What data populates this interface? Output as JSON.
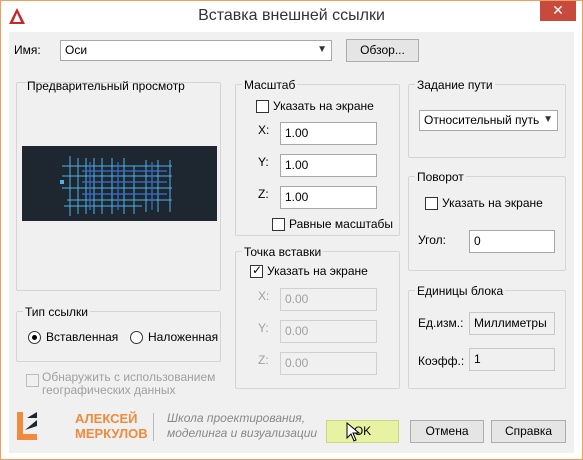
{
  "window": {
    "title": "Вставка внешней ссылки",
    "close_label": "✕"
  },
  "name_row": {
    "label": "Имя:",
    "value": "Оси",
    "browse_label": "Обзор..."
  },
  "preview": {
    "title": "Предварительный просмотр"
  },
  "scale": {
    "title": "Масштаб",
    "specify_on_screen": "Указать на экране",
    "x_label": "X:",
    "x_value": "1.00",
    "y_label": "Y:",
    "y_value": "1.00",
    "z_label": "Z:",
    "z_value": "1.00",
    "uniform_label": "Равные масштабы"
  },
  "path": {
    "title": "Задание пути",
    "value": "Относительный путь"
  },
  "rotation": {
    "title": "Поворот",
    "specify_on_screen": "Указать на экране",
    "angle_label": "Угол:",
    "angle_value": "0"
  },
  "insertion": {
    "title": "Точка вставки",
    "specify_on_screen": "Указать на экране",
    "x_label": "X:",
    "x_value": "0.00",
    "y_label": "Y:",
    "y_value": "0.00",
    "z_label": "Z:",
    "z_value": "0.00"
  },
  "reference_type": {
    "title": "Тип ссылки",
    "attached": "Вставленная",
    "overlay": "Наложенная"
  },
  "geo": {
    "label_line1": "Обнаружить с использованием",
    "label_line2": "географических данных"
  },
  "units": {
    "title": "Единицы блока",
    "unit_label": "Ед.изм.:",
    "unit_value": "Миллиметры",
    "factor_label": "Коэфф.:",
    "factor_value": "1"
  },
  "branding": {
    "name_line1": "АЛЕКСЕЙ",
    "name_line2": "МЕРКУЛОВ",
    "slogan_line1": "Школа проектирования,",
    "slogan_line2": "моделинга и визуализации"
  },
  "buttons": {
    "ok": "OK",
    "cancel": "Отмена",
    "help": "Справка"
  },
  "colors": {
    "accent": "#f08a3c",
    "preview_bg": "#1e2630",
    "preview_lines": "#4fb3e8",
    "close": "#c74a3c"
  }
}
